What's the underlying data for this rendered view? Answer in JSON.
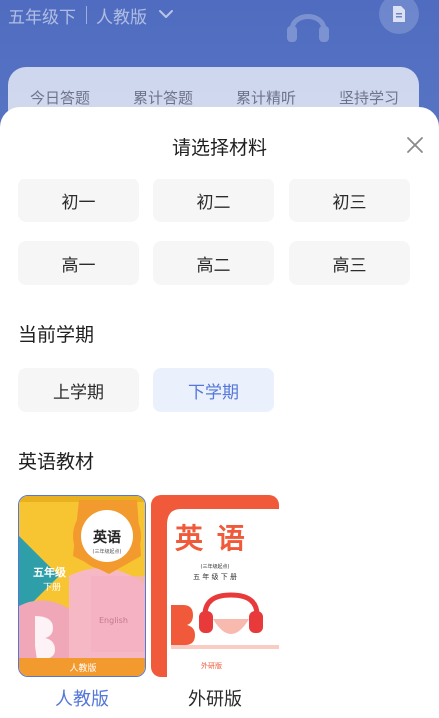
{
  "background": {
    "grade": "五年级下",
    "edition": "人教版",
    "stats": [
      "今日答题",
      "累计答题",
      "累计精听",
      "坚持学习"
    ]
  },
  "sheet": {
    "title": "请选择材料",
    "grades_row1": [
      "初一",
      "初二",
      "初三"
    ],
    "grades_row2": [
      "高一",
      "高二",
      "高三"
    ],
    "semester_title": "当前学期",
    "semesters": [
      "上学期",
      "下学期"
    ],
    "selected_semester": "下学期",
    "textbook_title": "英语教材",
    "textbooks": [
      {
        "name": "人教版",
        "cover": {
          "subject": "英语",
          "note": "(三年级起点)",
          "grade": "五年级",
          "volume": "下册",
          "publisher": "人教版",
          "english": "English"
        }
      },
      {
        "name": "外研版",
        "cover": {
          "subject": "英 语",
          "note": "(三年级起点)",
          "grade_volume": "五 年 级 下 册",
          "publisher": "外研版"
        }
      }
    ],
    "selected_textbook": "人教版"
  },
  "colors": {
    "accent": "#5577d8",
    "accent_bg": "#eaf0fc",
    "option_bg": "#f6f6f6"
  }
}
